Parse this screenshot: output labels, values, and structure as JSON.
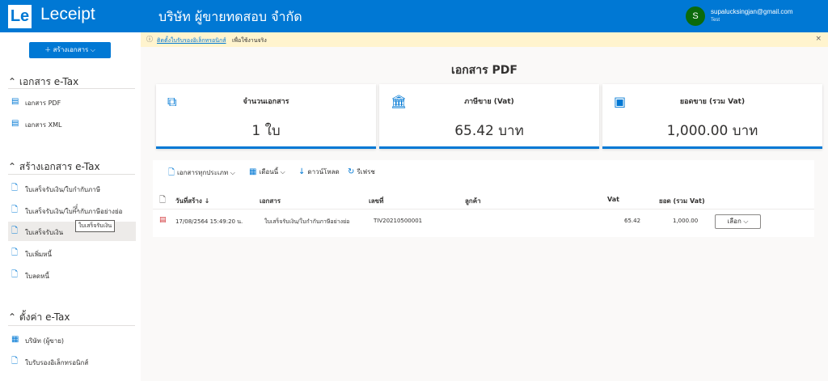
{
  "header": {
    "logo": "Le",
    "app_name": "Leceipt",
    "company": "บริษัท ผู้ขายทดสอบ จำกัด",
    "avatar": "S",
    "email": "supalucksingjan@gmail.com",
    "sub": "Test"
  },
  "sidebar": {
    "create_label": "＋ สร้างเอกสาร ⌵",
    "sections": [
      {
        "title": "⌃ เอกสาร e-Tax",
        "items": [
          "เอกสาร PDF",
          "เอกสาร XML"
        ]
      },
      {
        "title": "⌃ สร้างเอกสาร e-Tax",
        "items": [
          "ใบเสร็จรับเงิน/ใบกำกับภาษี",
          "ใบเสร็จรับเงิน/ใบกำกับภาษีอย่างย่อ",
          "ใบเสร็จรับเงิน",
          "ใบเพิ่มหนี้",
          "ใบลดหนี้"
        ]
      },
      {
        "title": "⌃ ตั้งค่า e-Tax",
        "items": [
          "บริษัท (ผู้ขาย)",
          "ใบรับรองอิเล็กทรอนิกส์"
        ]
      }
    ],
    "tooltip": "ใบเสร็จรับเงิน"
  },
  "notice": {
    "link": "ติดตั้งใบรับรองอิเล็กทรอนิกส์",
    "rest": "เพื่อใช้งานจริง",
    "close": "×"
  },
  "page_title": "เอกสาร PDF",
  "cards": [
    {
      "title": "จำนวนเอกสาร",
      "value": "1 ใบ"
    },
    {
      "title": "ภาษีขาย (Vat)",
      "value": "65.42 บาท"
    },
    {
      "title": "ยอดขาย (รวม Vat)",
      "value": "1,000.00 บาท"
    }
  ],
  "toolbar": {
    "doc_type": "เอกสารทุกประเภท",
    "month": "เดือนนี้",
    "download": "ดาวน์โหลด",
    "refresh": "รีเฟรช"
  },
  "table": {
    "headers": [
      "วันที่สร้าง ↓",
      "เอกสาร",
      "เลขที่",
      "ลูกค้า",
      "Vat",
      "ยอด (รวม Vat)"
    ],
    "rows": [
      {
        "date": "17/08/2564 15:49:20 น.",
        "doc": "ใบเสร็จรับเงิน/ใบกำกับภาษีอย่างย่อ",
        "number": "TIV20210500001",
        "customer": "",
        "vat": "65.42",
        "total": "1,000.00",
        "action": "เลือก ⌵"
      }
    ]
  },
  "colors": {
    "brand": "#0078d4",
    "avatar": "#0b6a0b",
    "notice_bg": "#fff4ce"
  }
}
